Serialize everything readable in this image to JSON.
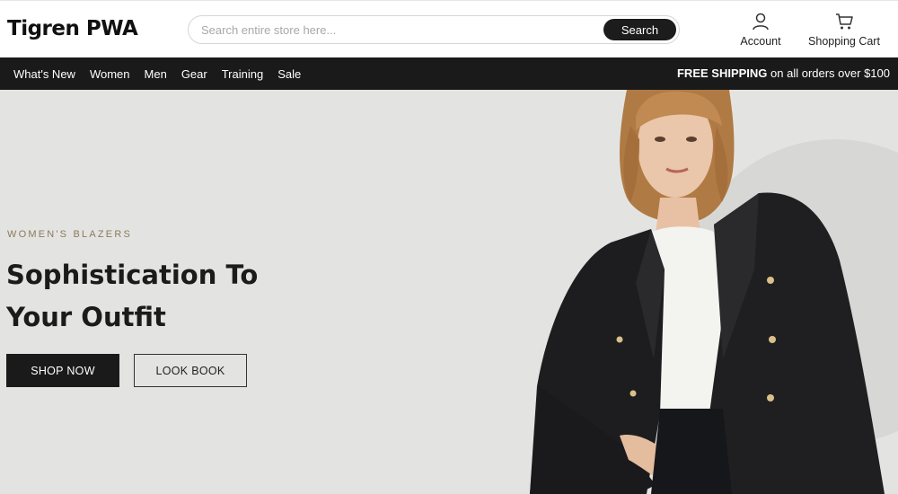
{
  "header": {
    "logo": "Tigren PWA",
    "search": {
      "placeholder": "Search entire store here...",
      "value": "",
      "button_label": "Search"
    },
    "account_label": "Account",
    "cart_label": "Shopping Cart"
  },
  "nav": {
    "items": [
      {
        "label": "What's New"
      },
      {
        "label": "Women"
      },
      {
        "label": "Men"
      },
      {
        "label": "Gear"
      },
      {
        "label": "Training"
      },
      {
        "label": "Sale"
      }
    ],
    "promo_bold": "FREE SHIPPING",
    "promo_rest": " on all orders over $100"
  },
  "hero": {
    "eyebrow": "WOMEN'S BLAZERS",
    "headline_line1": "Sophistication To",
    "headline_line2": "Your Outfit",
    "shop_button": "SHOP NOW",
    "lookbook_button": "LOOK BOOK"
  },
  "colors": {
    "nav_background": "#1a1a1a",
    "hero_background": "#e3e4e2",
    "eyebrow": "#8c7a5a",
    "primary_button": "#1a1a1a"
  },
  "icons": {
    "account": "user-icon",
    "cart": "shopping-cart-icon"
  }
}
